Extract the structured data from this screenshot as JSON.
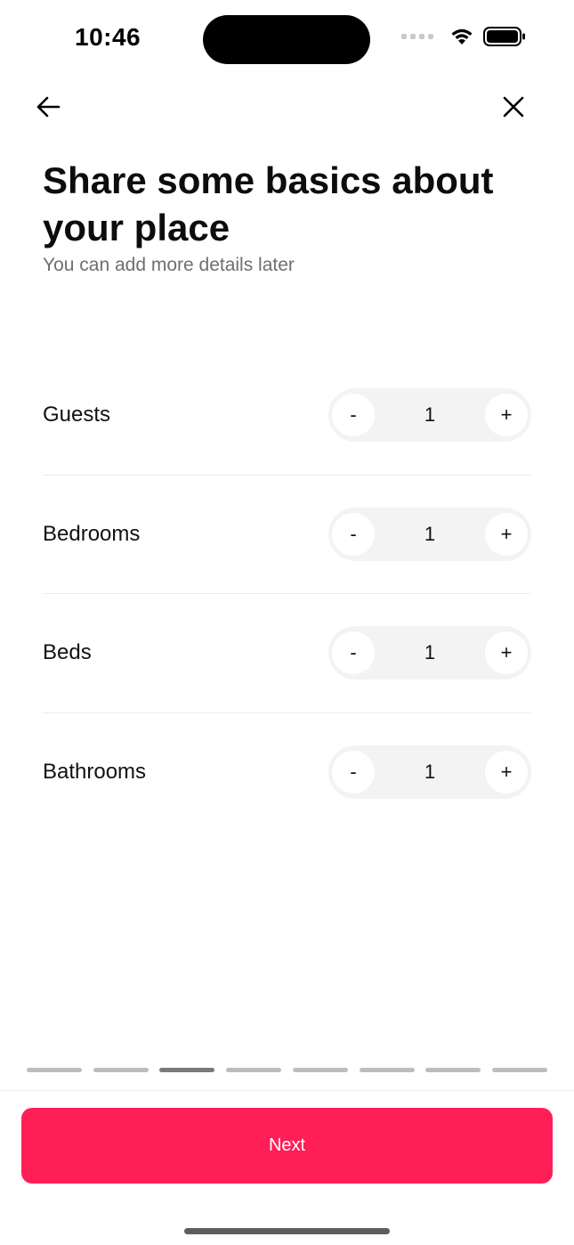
{
  "status_bar": {
    "time": "10:46"
  },
  "header": {
    "title": "Share some basics about your place",
    "subtitle": "You can add more details later"
  },
  "rows": [
    {
      "label": "Guests",
      "value": "1",
      "minus": "-",
      "plus": "+"
    },
    {
      "label": "Bedrooms",
      "value": "1",
      "minus": "-",
      "plus": "+"
    },
    {
      "label": "Beds",
      "value": "1",
      "minus": "-",
      "plus": "+"
    },
    {
      "label": "Bathrooms",
      "value": "1",
      "minus": "-",
      "plus": "+"
    }
  ],
  "progress": {
    "total_steps": 8,
    "current_step": 3
  },
  "footer": {
    "next_label": "Next"
  },
  "colors": {
    "accent": "#ff1f57"
  },
  "icons": {
    "back": "arrow-left-icon",
    "close": "close-icon",
    "wifi": "wifi-icon",
    "battery": "battery-icon",
    "signal": "signal-icon"
  }
}
